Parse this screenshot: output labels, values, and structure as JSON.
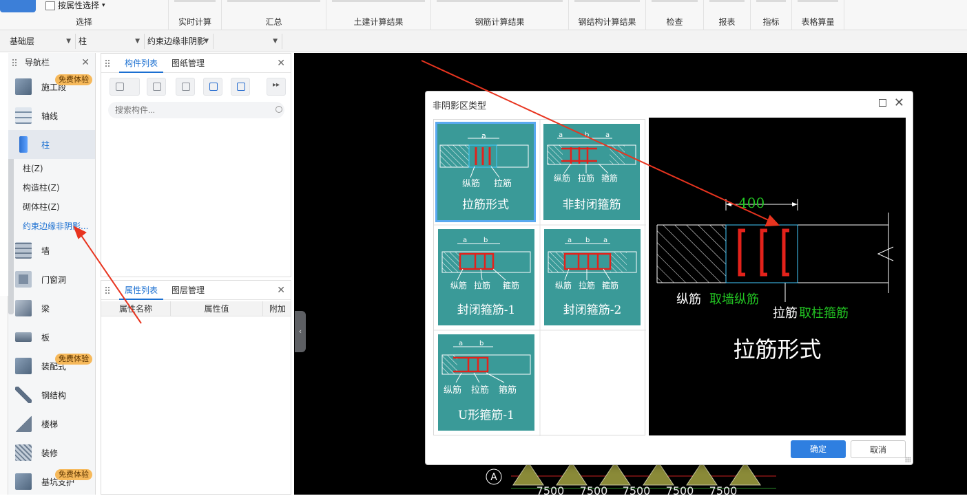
{
  "ribbon": {
    "select_group": "选择",
    "attr_select": "按属性选择",
    "groups": [
      "实时计算",
      "汇总",
      "土建计算结果",
      "钢筋计算结果",
      "钢结构计算结果",
      "检查",
      "报表",
      "指标",
      "表格算量"
    ]
  },
  "filter": {
    "floor": "基础层",
    "category": "柱",
    "type": "约束边缘非阴影"
  },
  "nav": {
    "title": "导航栏",
    "badge": "免费体验",
    "items": [
      "施工段",
      "轴线",
      "柱",
      "墙",
      "门窗洞",
      "梁",
      "板",
      "装配式",
      "钢结构",
      "楼梯",
      "装修",
      "基坑支护"
    ],
    "sub_items": [
      "柱(Z)",
      "构造柱(Z)",
      "砌体柱(Z)",
      "约束边缘非阴影..."
    ]
  },
  "component_panel": {
    "tab_active": "构件列表",
    "tab_other": "图纸管理",
    "search_placeholder": "搜索构件..."
  },
  "property_panel": {
    "tab_active": "属性列表",
    "tab_other": "图层管理",
    "col_name": "属性名称",
    "col_value": "属性值",
    "col_extra": "附加"
  },
  "dialog": {
    "title": "非阴影区类型",
    "ok": "确定",
    "cancel": "取消",
    "tiles": [
      {
        "name": "拉筋形式",
        "dim1": "a",
        "dim2": "",
        "labels": [
          "纵筋",
          "拉筋"
        ]
      },
      {
        "name": "非封闭箍筋",
        "dim1": "a",
        "dim2": "b",
        "labels": [
          "纵筋",
          "拉筋",
          "箍筋"
        ]
      },
      {
        "name": "封闭箍筋-1",
        "dim1": "a",
        "dim2": "b",
        "labels": [
          "纵筋",
          "拉筋",
          "箍筋"
        ]
      },
      {
        "name": "封闭箍筋-2",
        "dim1": "a",
        "dim2": "b",
        "labels": [
          "纵筋",
          "拉筋",
          "箍筋"
        ]
      },
      {
        "name": "U形箍筋-1",
        "dim1": "a",
        "dim2": "b",
        "labels": [
          "纵筋",
          "拉筋",
          "箍筋"
        ]
      }
    ],
    "preview": {
      "dimension": "400",
      "label_vertical": "纵筋",
      "label_vertical_note": "取墙纵筋",
      "label_tie": "拉筋",
      "label_tie_note": "取柱箍筋",
      "title": "拉筋形式"
    }
  },
  "cad": {
    "axis_label": "A",
    "spans": [
      "7500",
      "7500",
      "7500",
      "7500",
      "7500"
    ]
  },
  "colors": {
    "accent": "#2f7fe0",
    "tile": "#3a9a98",
    "rebar": "#e3221b",
    "annotation_green": "#22c322",
    "arrow": "#e8341f"
  }
}
